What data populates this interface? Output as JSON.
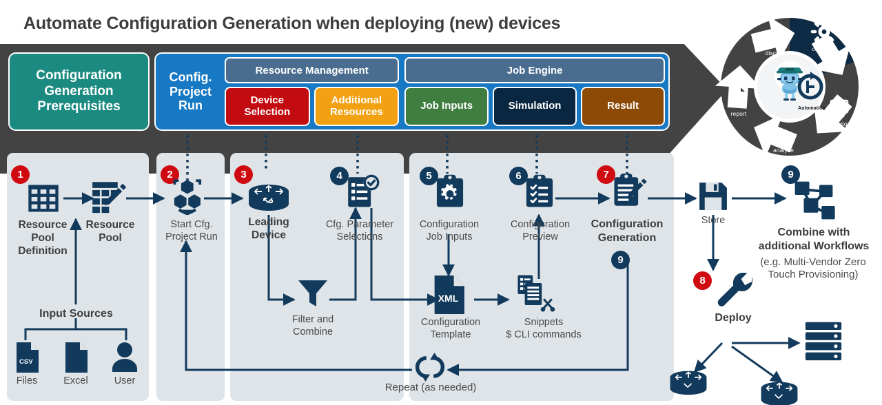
{
  "title": "Automate Configuration Generation when deploying (new) devices",
  "header": {
    "prerequisites": "Configuration\nGeneration\nPrerequisites",
    "project_run": "Config.\nProject\nRun",
    "groups": [
      {
        "name": "Resource Management",
        "items": [
          {
            "label": "Device\nSelection",
            "color": "#c30c12"
          },
          {
            "label": "Additional\nResources",
            "color": "#f2a112"
          }
        ]
      },
      {
        "name": "Job Engine",
        "items": [
          {
            "label": "Job Inputs",
            "color": "#3f7d40"
          },
          {
            "label": "Simulation",
            "color": "#0a2742"
          },
          {
            "label": "Result",
            "color": "#8c4a06"
          }
        ]
      }
    ]
  },
  "steps": [
    {
      "num": "1",
      "color": "red",
      "label": "Resource\nPool\nDefinition",
      "icon": "table-grid-icon"
    },
    {
      "num": "2",
      "color": "red",
      "label": "Start Cfg.\nProject Run",
      "icon": "hexagons-icon"
    },
    {
      "num": "3",
      "color": "red",
      "label": "Leading\nDevice",
      "icon": "router-icon"
    },
    {
      "num": "4",
      "color": "navy",
      "label": "Cfg. Parameter\nSelections",
      "icon": "checklist-check-icon"
    },
    {
      "num": "5",
      "color": "navy",
      "label": "Configuration\nJob Inputs",
      "icon": "clipboard-gear-icon"
    },
    {
      "num": "6",
      "color": "navy",
      "label": "Configuration\nPreview",
      "icon": "clipboard-checklist-icon"
    },
    {
      "num": "7",
      "color": "red",
      "label": "Configuration\nGeneration",
      "icon": "clipboard-pencil-icon"
    },
    {
      "num": "8",
      "color": "red",
      "label": "Deploy",
      "icon": "wrench-icon"
    },
    {
      "num": "9",
      "color": "navy",
      "label": "Combine with\nadditional Workflows\n(e.g. Multi-Vendor Zero\nTouch Provisioning)",
      "icon": "network-nodes-icon"
    }
  ],
  "nodes": {
    "resource_pool": "Resource\nPool",
    "input_sources": "Input Sources",
    "files": "Files",
    "files_tag": "CSV",
    "excel": "Excel",
    "user": "User",
    "filter_combine": "Filter and\nCombine",
    "config_template": "Configuration\nTemplate",
    "template_tag": "XML",
    "snippets": "Snippets\n$ CLI commands",
    "store": "Store",
    "deploy": "Deploy",
    "repeat": "Repeat (as needed)",
    "combine_title": "Combine with\nadditional Workflows",
    "combine_sub": "(e.g. Multi-Vendor Zero\nTouch Provisioning)",
    "generation": "Configuration\nGeneration",
    "badge9_inline": "9"
  },
  "automation_wheel": {
    "center_label": "Automation",
    "segments": [
      {
        "label": "discover",
        "icon": "magnifier-icon"
      },
      {
        "label": "configure",
        "icon": "gear-icon"
      },
      {
        "label": "monitor",
        "icon": "monitor-icon"
      },
      {
        "label": "analyze",
        "icon": "waveform-icon"
      },
      {
        "label": "report",
        "icon": "document-icon"
      }
    ]
  },
  "colors": {
    "teal": "#1b8a80",
    "blue": "#1779c4",
    "slate": "#4a6c8f",
    "red": "#c30c12",
    "orange": "#f2a112",
    "green": "#3f7d40",
    "navy": "#0a2742",
    "brown": "#8c4a06",
    "badge_red": "#cf0a11",
    "badge_navy": "#123a5c",
    "panel": "#dfe4e8",
    "band": "#434343",
    "text": "#4a4a4a"
  }
}
